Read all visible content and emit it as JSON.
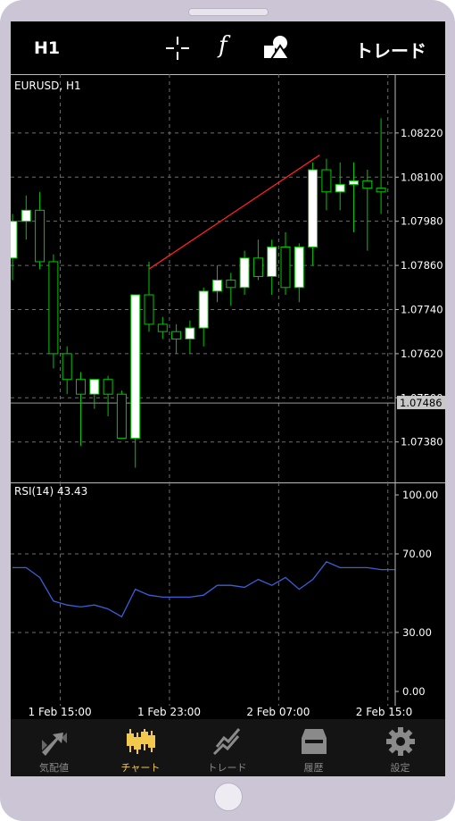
{
  "toolbar": {
    "timeframe": "H1",
    "trade_label": "トレード"
  },
  "chart_data": [
    {
      "type": "candlestick",
      "title": "EURUSD, H1",
      "current_price": "1.07486",
      "ylim": [
        1.0727,
        1.0838
      ],
      "yticks": [
        "1.08220",
        "1.08100",
        "1.07980",
        "1.07860",
        "1.07740",
        "1.07620",
        "1.07500",
        "1.07380"
      ],
      "xticks": [
        "1 Feb 15:00",
        "1 Feb 23:00",
        "2 Feb 07:00",
        "2 Feb 15:0"
      ],
      "colors": {
        "bull": "#ffffff",
        "bear": "#000000",
        "wick": "#00c800",
        "trendline": "#ff2020",
        "grid": "#6e6e6e"
      },
      "candles": [
        {
          "o": 1.0788,
          "h": 1.08,
          "l": 1.0782,
          "c": 1.0798
        },
        {
          "o": 1.0798,
          "h": 1.0805,
          "l": 1.0793,
          "c": 1.0801
        },
        {
          "o": 1.0801,
          "h": 1.0806,
          "l": 1.0785,
          "c": 1.0787
        },
        {
          "o": 1.0787,
          "h": 1.0789,
          "l": 1.0758,
          "c": 1.0762
        },
        {
          "o": 1.0762,
          "h": 1.0764,
          "l": 1.0751,
          "c": 1.0755
        },
        {
          "o": 1.0755,
          "h": 1.0757,
          "l": 1.0737,
          "c": 1.0751
        },
        {
          "o": 1.0751,
          "h": 1.0753,
          "l": 1.0747,
          "c": 1.0755
        },
        {
          "o": 1.0755,
          "h": 1.0756,
          "l": 1.0745,
          "c": 1.0751
        },
        {
          "o": 1.0751,
          "h": 1.0752,
          "l": 1.0742,
          "c": 1.0739
        },
        {
          "o": 1.0739,
          "h": 1.0741,
          "l": 1.0731,
          "c": 1.0778
        },
        {
          "o": 1.0778,
          "h": 1.0787,
          "l": 1.0768,
          "c": 1.077
        },
        {
          "o": 1.077,
          "h": 1.0772,
          "l": 1.0766,
          "c": 1.0768
        },
        {
          "o": 1.0768,
          "h": 1.077,
          "l": 1.0762,
          "c": 1.0766
        },
        {
          "o": 1.0766,
          "h": 1.0771,
          "l": 1.0762,
          "c": 1.0769
        },
        {
          "o": 1.0769,
          "h": 1.078,
          "l": 1.0764,
          "c": 1.0779
        },
        {
          "o": 1.0779,
          "h": 1.0786,
          "l": 1.0776,
          "c": 1.0782
        },
        {
          "o": 1.0782,
          "h": 1.0784,
          "l": 1.0775,
          "c": 1.078
        },
        {
          "o": 1.078,
          "h": 1.079,
          "l": 1.0778,
          "c": 1.0788
        },
        {
          "o": 1.0788,
          "h": 1.0793,
          "l": 1.0782,
          "c": 1.0783
        },
        {
          "o": 1.0783,
          "h": 1.0793,
          "l": 1.0778,
          "c": 1.0791
        },
        {
          "o": 1.0791,
          "h": 1.0795,
          "l": 1.0778,
          "c": 1.078
        },
        {
          "o": 1.078,
          "h": 1.0792,
          "l": 1.0776,
          "c": 1.0791
        },
        {
          "o": 1.0791,
          "h": 1.0814,
          "l": 1.0786,
          "c": 1.0812
        },
        {
          "o": 1.0812,
          "h": 1.0815,
          "l": 1.0801,
          "c": 1.0806
        },
        {
          "o": 1.0806,
          "h": 1.0814,
          "l": 1.0801,
          "c": 1.0808
        },
        {
          "o": 1.0808,
          "h": 1.0814,
          "l": 1.0795,
          "c": 1.0809
        },
        {
          "o": 1.0809,
          "h": 1.0812,
          "l": 1.079,
          "c": 1.0807
        },
        {
          "o": 1.0807,
          "h": 1.0826,
          "l": 1.08,
          "c": 1.0806
        }
      ],
      "trendline": {
        "x1": 10,
        "y1": 1.0785,
        "x2": 22.5,
        "y2": 1.0816
      }
    },
    {
      "type": "line",
      "title": "RSI(14) 43.43",
      "ylim": [
        0,
        100
      ],
      "yticks": [
        "100.00",
        "70.00",
        "30.00",
        "0.00"
      ],
      "colors": {
        "line": "#3a5fd9",
        "grid": "#6e6e6e"
      },
      "series": [
        {
          "values": [
            63,
            63,
            58,
            46,
            44,
            43,
            44,
            42,
            38,
            52,
            49,
            48,
            48,
            48,
            49,
            54,
            54,
            53,
            57,
            54,
            58,
            52,
            57,
            66,
            63,
            63,
            63,
            62,
            62
          ]
        }
      ]
    }
  ],
  "nav": [
    {
      "label": "気配値",
      "icon": "quotes-icon"
    },
    {
      "label": "チャート",
      "icon": "chart-icon"
    },
    {
      "label": "トレード",
      "icon": "trade-icon"
    },
    {
      "label": "履歴",
      "icon": "history-icon"
    },
    {
      "label": "設定",
      "icon": "settings-icon"
    }
  ]
}
